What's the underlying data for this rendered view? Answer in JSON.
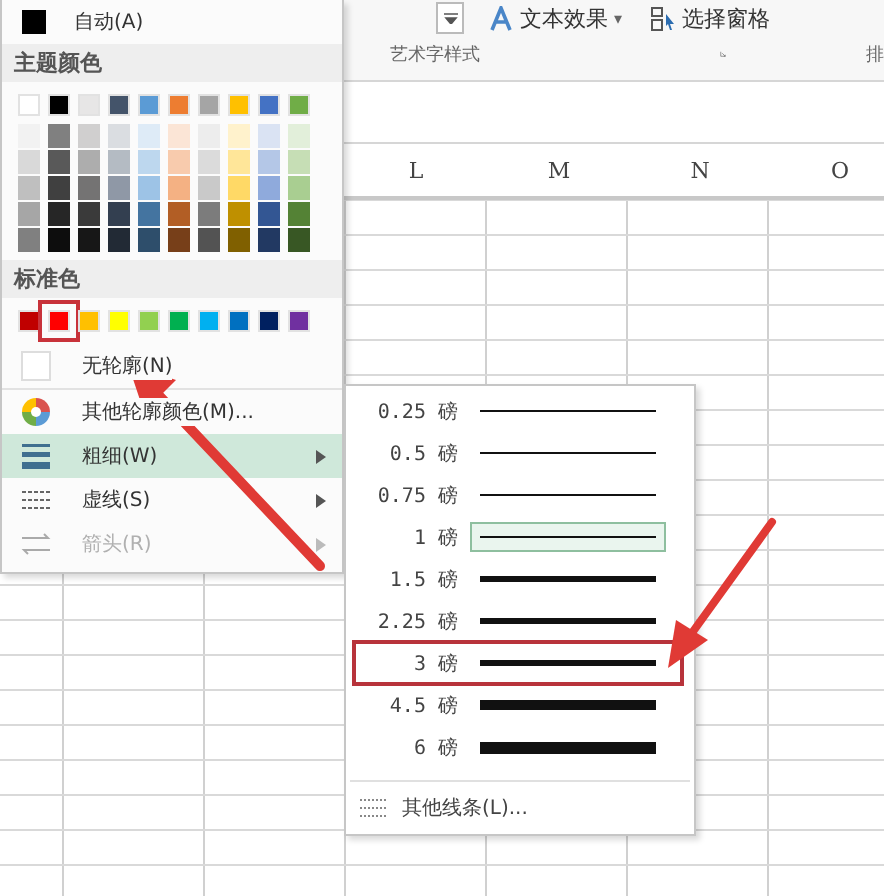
{
  "ribbon": {
    "text_effects": "文本效果",
    "text_effects_caret": "▾",
    "selection_pane": "选择窗格",
    "group_label": "艺术字样式",
    "next_group_label": "排"
  },
  "sheet": {
    "columns": [
      "L",
      "M",
      "N",
      "O"
    ]
  },
  "outline_menu": {
    "auto": "自动(A)",
    "theme_header": "主题颜色",
    "theme_colors": [
      {
        "color": "#ffffff"
      },
      {
        "color": "#000000"
      },
      {
        "color": "#e7e6e6"
      },
      {
        "color": "#44546a"
      },
      {
        "color": "#5b9bd5"
      },
      {
        "color": "#ed7d31"
      },
      {
        "color": "#a5a5a5"
      },
      {
        "color": "#ffc000"
      },
      {
        "color": "#4472c4"
      },
      {
        "color": "#70ad47"
      }
    ],
    "standard_header": "标准色",
    "standard_colors": [
      {
        "color": "#c00000",
        "annotated": false
      },
      {
        "color": "#ff0000",
        "annotated": true
      },
      {
        "color": "#ffc000",
        "annotated": false
      },
      {
        "color": "#ffff00",
        "annotated": false
      },
      {
        "color": "#92d050",
        "annotated": false
      },
      {
        "color": "#00b050",
        "annotated": false
      },
      {
        "color": "#00b0f0",
        "annotated": false
      },
      {
        "color": "#0070c0",
        "annotated": false
      },
      {
        "color": "#002060",
        "annotated": false
      },
      {
        "color": "#7030a0",
        "annotated": false
      }
    ],
    "items": [
      {
        "kind": "none",
        "label": "无轮廓(N)",
        "has_submenu": false,
        "highlighted": false,
        "disabled": false
      },
      {
        "kind": "more",
        "label": "其他轮廓颜色(M)...",
        "has_submenu": false,
        "highlighted": false,
        "disabled": false
      },
      {
        "kind": "weight",
        "label": "粗细(W)",
        "has_submenu": true,
        "highlighted": true,
        "disabled": false
      },
      {
        "kind": "dash",
        "label": "虚线(S)",
        "has_submenu": true,
        "highlighted": false,
        "disabled": false
      },
      {
        "kind": "arrow",
        "label": "箭头(R)",
        "has_submenu": true,
        "highlighted": false,
        "disabled": true
      }
    ]
  },
  "weight_menu": {
    "weights": [
      {
        "label": "0.25 磅",
        "selected": false,
        "annotated": false
      },
      {
        "label": "0.5 磅",
        "selected": false,
        "annotated": false
      },
      {
        "label": "0.75 磅",
        "selected": false,
        "annotated": false
      },
      {
        "label": "1 磅",
        "selected": true,
        "annotated": false
      },
      {
        "label": "1.5 磅",
        "selected": false,
        "annotated": false
      },
      {
        "label": "2.25 磅",
        "selected": false,
        "annotated": false
      },
      {
        "label": "3 磅",
        "selected": false,
        "annotated": true
      },
      {
        "label": "4.5 磅",
        "selected": false,
        "annotated": false
      },
      {
        "label": "6 磅",
        "selected": false,
        "annotated": false
      }
    ],
    "more": "其他线条(L)..."
  }
}
